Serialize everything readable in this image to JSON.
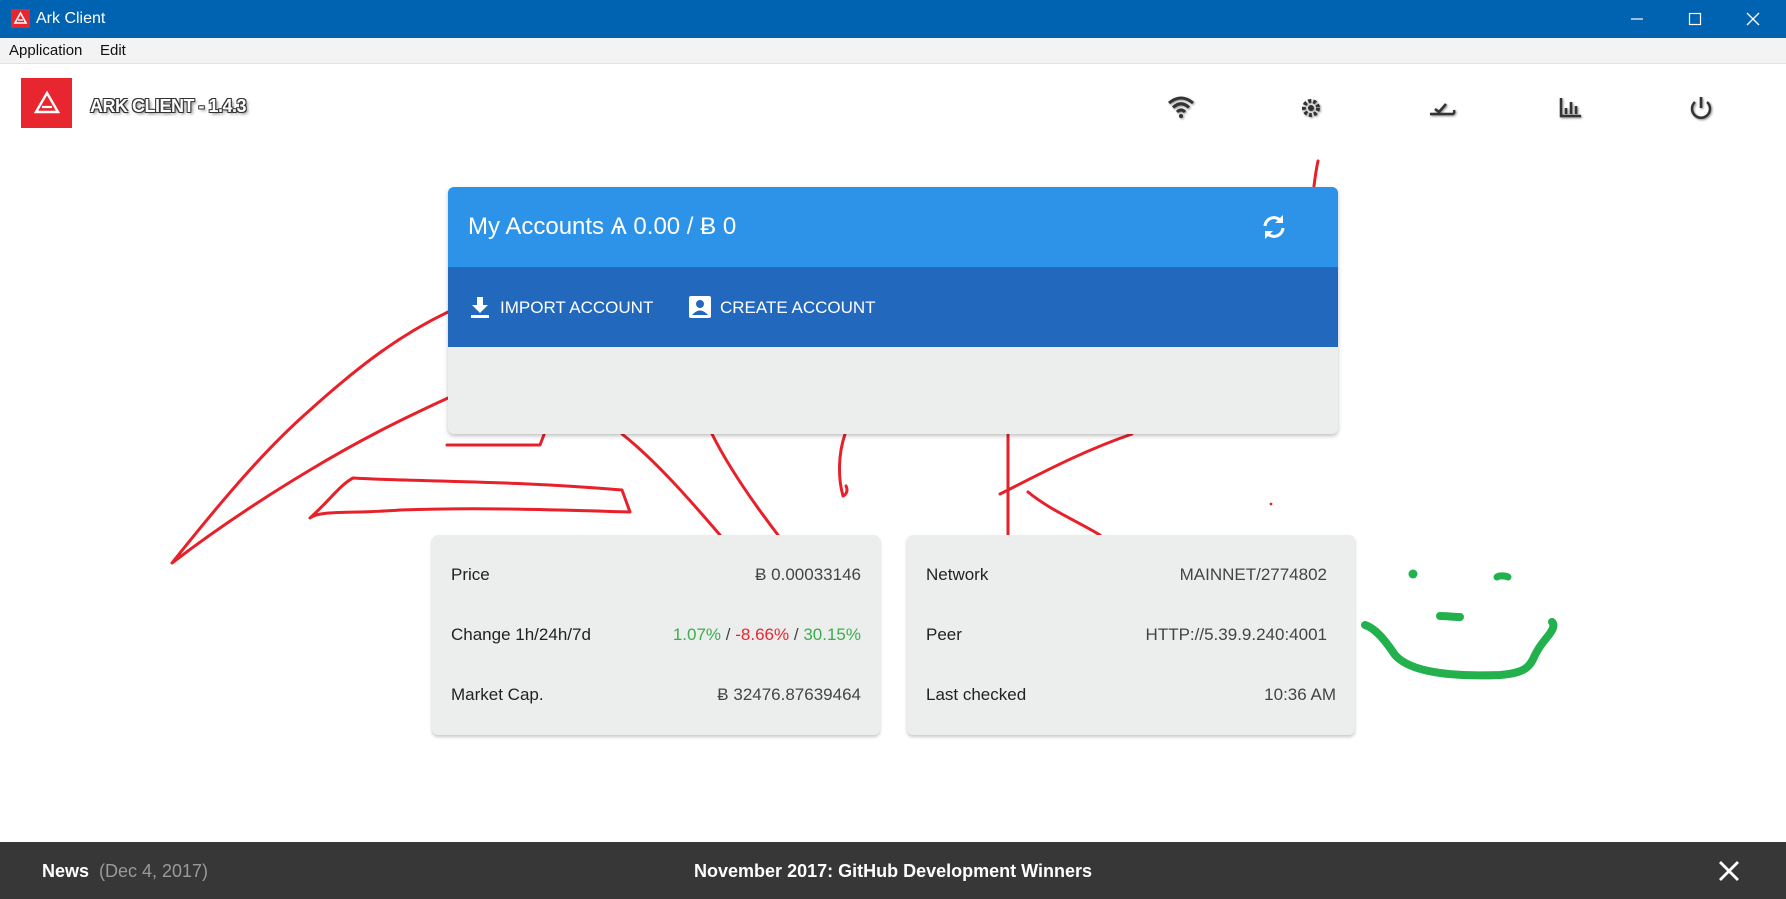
{
  "window": {
    "title": "Ark Client",
    "controls": [
      "minimize",
      "maximize",
      "close"
    ]
  },
  "menu": {
    "items": [
      "Application",
      "Edit"
    ]
  },
  "header": {
    "app_name": "ARK CLIENT - 1.4.3",
    "icons": [
      "wifi-icon",
      "settings-icon",
      "cloud-check-icon",
      "chart-icon",
      "power-icon"
    ]
  },
  "accounts": {
    "title": "My Accounts Ѧ 0.00 / Ƀ 0",
    "import_label": "IMPORT ACCOUNT",
    "create_label": "CREATE ACCOUNT"
  },
  "market": {
    "price_label": "Price",
    "price_value": "Ƀ 0.00033146",
    "change_label": "Change 1h/24h/7d",
    "change_1h": "1.07%",
    "change_24h": "-8.66%",
    "change_7d": "30.15%",
    "sep": "/",
    "cap_label": "Market Cap.",
    "cap_value": "Ƀ 32476.87639464"
  },
  "network": {
    "network_label": "Network",
    "network_value": "MAINNET/2774802",
    "peer_label": "Peer",
    "peer_value": "HTTP://5.39.9.240:4001",
    "checked_label": "Last checked",
    "checked_value": "10:36 AM"
  },
  "news": {
    "label": "News",
    "date": "(Dec 4, 2017)",
    "title": "November 2017: GitHub Development Winners"
  },
  "colors": {
    "titlebar": "#0063b1",
    "brand_red": "#e8262f",
    "card_head": "#2c93e8",
    "card_actions": "#2269bd",
    "positive": "#3bad4b",
    "negative": "#e8262f",
    "footer": "#373737",
    "doodle_red": "#e8202a",
    "doodle_green": "#22b14c"
  }
}
